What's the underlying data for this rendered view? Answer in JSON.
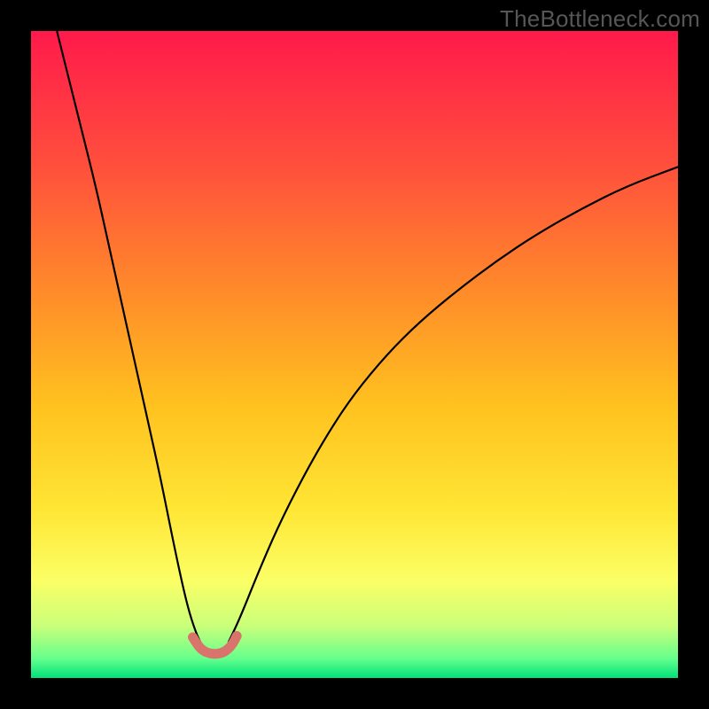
{
  "watermark": "TheBottleneck.com",
  "chart_data": {
    "type": "line",
    "title": "",
    "xlabel": "",
    "ylabel": "",
    "xlim": [
      0,
      100
    ],
    "ylim": [
      0,
      100
    ],
    "grid": false,
    "legend": false,
    "background_gradient": {
      "stops": [
        {
          "offset": 0.0,
          "color": "#ff1a4b"
        },
        {
          "offset": 0.2,
          "color": "#ff4d3d"
        },
        {
          "offset": 0.4,
          "color": "#ff8a2a"
        },
        {
          "offset": 0.58,
          "color": "#ffc21f"
        },
        {
          "offset": 0.74,
          "color": "#ffe635"
        },
        {
          "offset": 0.85,
          "color": "#fbff66"
        },
        {
          "offset": 0.92,
          "color": "#c9ff7a"
        },
        {
          "offset": 0.97,
          "color": "#66ff8c"
        },
        {
          "offset": 1.0,
          "color": "#00e37a"
        }
      ]
    },
    "series": [
      {
        "name": "left-branch",
        "stroke": "#000000",
        "stroke_width": 2.2,
        "x": [
          4,
          6,
          8,
          10,
          12,
          14,
          16,
          18,
          20,
          22,
          23.5,
          24.5,
          25.5,
          26.2
        ],
        "y": [
          100,
          92,
          84,
          76,
          67,
          58,
          49,
          40,
          31,
          21,
          14,
          10,
          7,
          5.5
        ]
      },
      {
        "name": "right-branch",
        "stroke": "#000000",
        "stroke_width": 2.2,
        "x": [
          30.5,
          31.5,
          33,
          35,
          38,
          42,
          46,
          50,
          55,
          60,
          66,
          72,
          78,
          85,
          92,
          100
        ],
        "y": [
          5.5,
          7.5,
          11,
          16,
          23,
          31,
          38,
          44,
          50,
          55,
          60,
          64.5,
          68.5,
          72.5,
          76,
          79
        ]
      },
      {
        "name": "trough-marker",
        "stroke": "#d9746d",
        "stroke_width": 11,
        "linecap": "round",
        "x": [
          25.0,
          25.8,
          26.6,
          27.6,
          28.6,
          29.6,
          30.4,
          31.2,
          31.8
        ],
        "y": [
          6.3,
          5.0,
          4.2,
          3.8,
          3.7,
          3.9,
          4.4,
          5.3,
          6.5
        ]
      }
    ]
  }
}
